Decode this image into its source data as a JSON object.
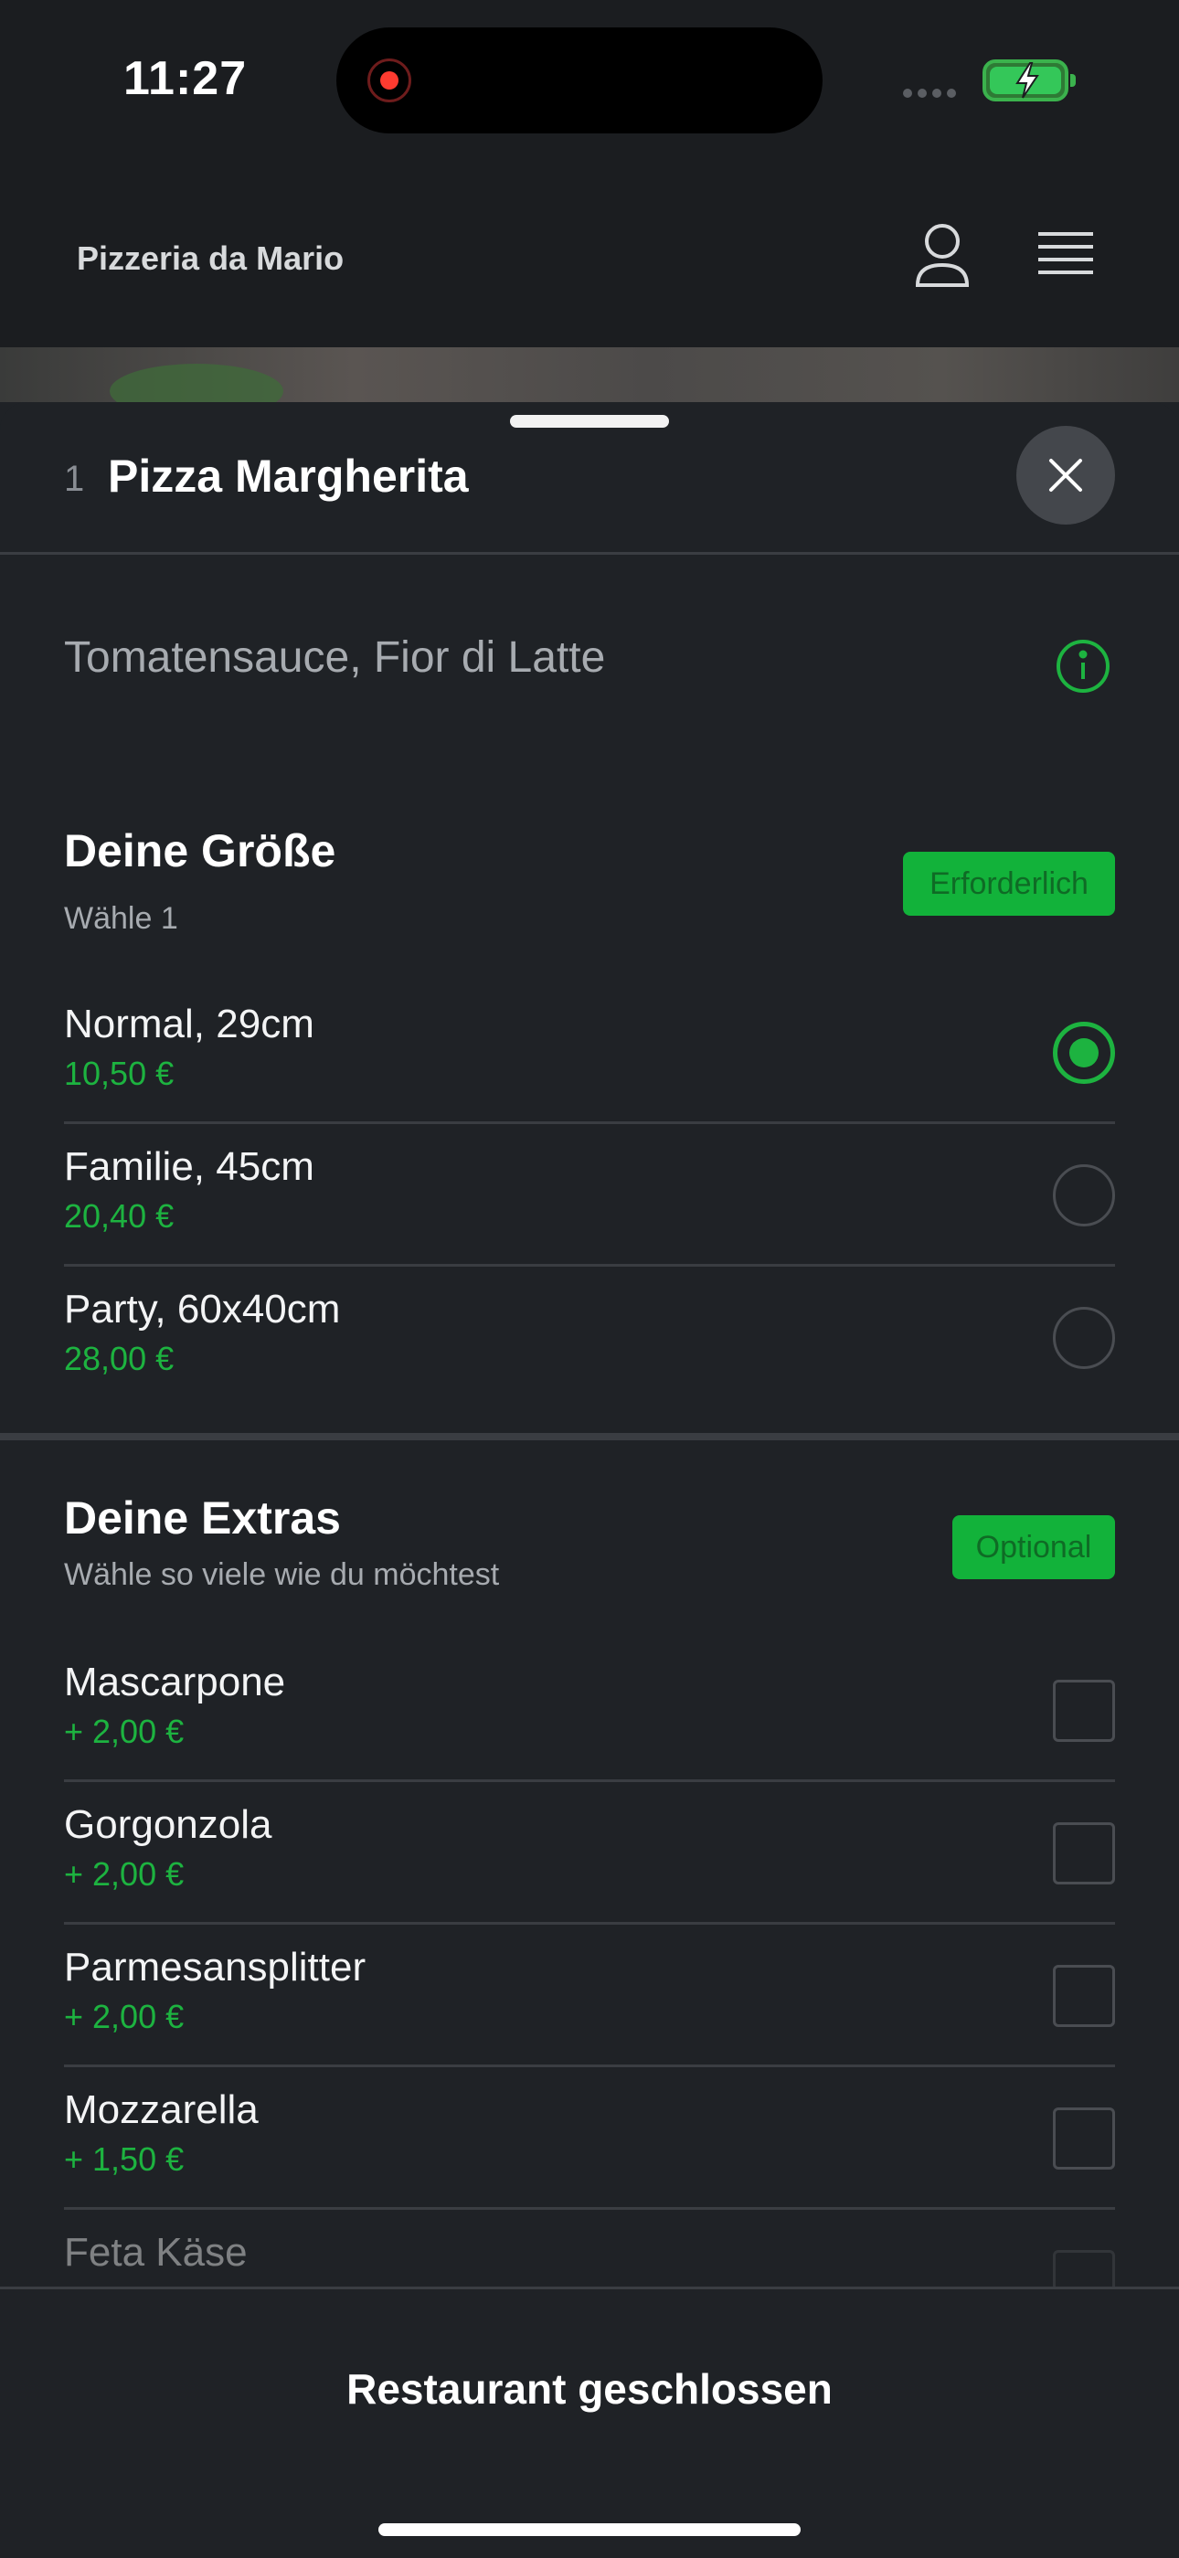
{
  "status_bar": {
    "time": "11:27"
  },
  "nav": {
    "brand": "Pizzeria da Mario",
    "icons": [
      "user-icon",
      "menu-icon"
    ]
  },
  "item": {
    "number": "1",
    "title": "Pizza Margherita",
    "description": "Tomatensauce, Fior di Latte"
  },
  "size_group": {
    "title": "Deine Größe",
    "subtitle": "Wähle 1",
    "badge": "Erforderlich",
    "options": [
      {
        "name": "Normal, 29cm",
        "price": "10,50 €",
        "selected": true
      },
      {
        "name": "Familie, 45cm",
        "price": "20,40 €",
        "selected": false
      },
      {
        "name": "Party, 60x40cm",
        "price": "28,00 €",
        "selected": false
      }
    ]
  },
  "extras_group": {
    "title": "Deine Extras",
    "subtitle": "Wähle so viele wie du möchtest",
    "badge": "Optional",
    "options": [
      {
        "name": "Mascarpone",
        "price": "+ 2,00 €",
        "checked": false
      },
      {
        "name": "Gorgonzola",
        "price": "+ 2,00 €",
        "checked": false
      },
      {
        "name": "Parmesansplitter",
        "price": "+ 2,00 €",
        "checked": false
      },
      {
        "name": "Mozzarella",
        "price": "+ 1,50 €",
        "checked": false
      },
      {
        "name": "Feta Käse",
        "checked": false
      }
    ]
  },
  "footer": {
    "status": "Restaurant geschlossen"
  },
  "colors": {
    "accent": "#1db340",
    "badge": "#12b23a",
    "background": "#1f2226"
  }
}
